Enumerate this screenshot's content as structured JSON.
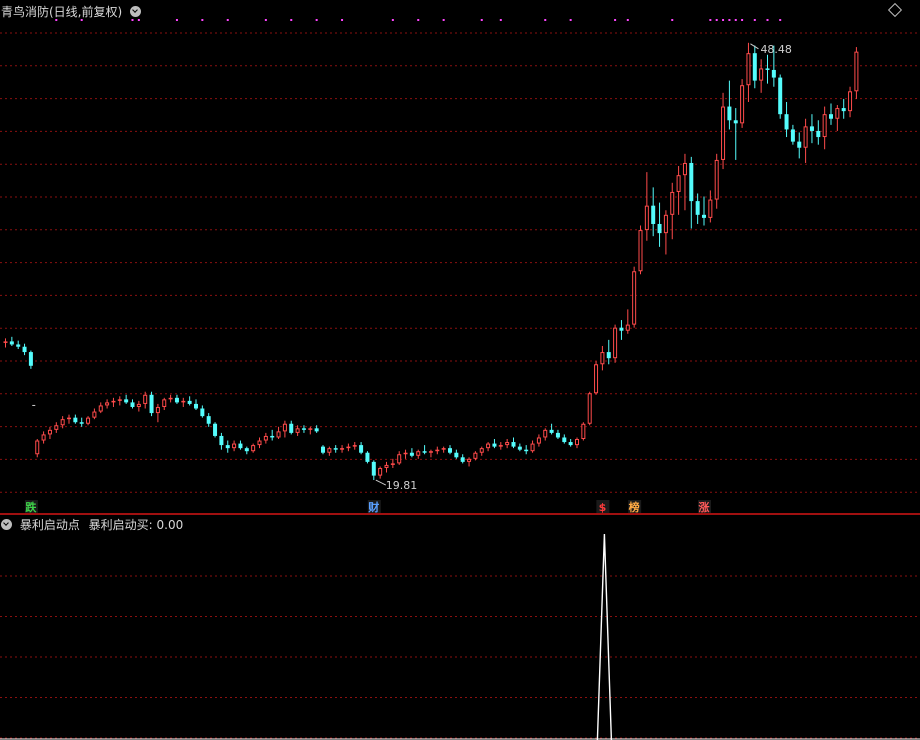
{
  "top_panel": {
    "title": "青鸟消防(日线,前复权)",
    "high_label": "48.48",
    "low_label": "19.81",
    "signal_labels": [
      {
        "index": 4,
        "text": "跌",
        "color": "#3fd24a"
      },
      {
        "index": 58,
        "text": "财",
        "color": "#5aa0ff"
      },
      {
        "index": 94,
        "text": "$",
        "color": "#ff3b3b"
      },
      {
        "index": 99,
        "text": "榜",
        "color": "#ffaa44"
      },
      {
        "index": 110,
        "text": "涨",
        "color": "#ff5a5a"
      }
    ]
  },
  "bottom_panel": {
    "indicator_name": "暴利启动点",
    "indicator_value_text": "暴利启动买: 0.00"
  },
  "colors": {
    "up": "#ff4b4b",
    "down": "#54fcfc",
    "grid": "#8a1010",
    "divider": "#a01010",
    "marker": "#ff44ff",
    "indicator_line": "#ffffff"
  },
  "icons": [
    "collapse-circle-icon",
    "diamond-icon"
  ],
  "chart_data": {
    "type": "candlestick",
    "title": "青鸟消防(日线,前复权)",
    "ylim": [
      18.5,
      50.5
    ],
    "grid": true,
    "candles": [
      [
        28.8,
        29.1,
        28.5,
        28.9
      ],
      [
        28.9,
        29.2,
        28.6,
        28.7
      ],
      [
        28.7,
        28.95,
        28.4,
        28.55
      ],
      [
        28.55,
        28.75,
        28.0,
        28.2
      ],
      [
        28.2,
        28.3,
        27.1,
        27.3
      ],
      [
        21.5,
        22.5,
        21.3,
        22.4
      ],
      [
        22.4,
        23.0,
        22.2,
        22.8
      ],
      [
        22.8,
        23.3,
        22.5,
        23.1
      ],
      [
        23.1,
        23.6,
        22.9,
        23.4
      ],
      [
        23.4,
        24.0,
        23.2,
        23.8
      ],
      [
        23.8,
        24.1,
        23.5,
        23.9
      ],
      [
        23.9,
        24.1,
        23.5,
        23.6
      ],
      [
        23.6,
        23.9,
        23.3,
        23.5
      ],
      [
        23.5,
        24.0,
        23.4,
        23.9
      ],
      [
        23.9,
        24.5,
        23.8,
        24.3
      ],
      [
        24.3,
        24.9,
        24.2,
        24.7
      ],
      [
        24.7,
        25.1,
        24.5,
        24.9
      ],
      [
        24.9,
        25.2,
        24.6,
        25.0
      ],
      [
        25.0,
        25.3,
        24.7,
        25.1
      ],
      [
        25.1,
        25.4,
        24.8,
        24.9
      ],
      [
        24.9,
        25.1,
        24.5,
        24.6
      ],
      [
        24.6,
        25.0,
        24.3,
        24.8
      ],
      [
        24.8,
        25.6,
        24.5,
        25.4
      ],
      [
        25.4,
        25.6,
        24.0,
        24.2
      ],
      [
        24.2,
        24.8,
        23.6,
        24.6
      ],
      [
        24.6,
        25.2,
        24.4,
        25.1
      ],
      [
        25.1,
        25.4,
        24.9,
        25.2
      ],
      [
        25.2,
        25.4,
        24.8,
        24.9
      ],
      [
        24.9,
        25.2,
        24.6,
        25.0
      ],
      [
        25.0,
        25.3,
        24.7,
        24.8
      ],
      [
        24.8,
        25.1,
        24.4,
        24.5
      ],
      [
        24.5,
        24.7,
        23.9,
        24.0
      ],
      [
        24.0,
        24.2,
        23.3,
        23.5
      ],
      [
        23.5,
        23.6,
        22.6,
        22.7
      ],
      [
        22.7,
        22.9,
        21.8,
        22.1
      ],
      [
        22.1,
        22.4,
        21.6,
        21.9
      ],
      [
        21.9,
        22.4,
        21.7,
        22.2
      ],
      [
        22.2,
        22.4,
        21.8,
        21.9
      ],
      [
        21.9,
        22.0,
        21.5,
        21.7
      ],
      [
        21.7,
        22.2,
        21.6,
        22.1
      ],
      [
        22.1,
        22.6,
        21.9,
        22.4
      ],
      [
        22.4,
        22.9,
        22.2,
        22.7
      ],
      [
        22.7,
        23.1,
        22.4,
        22.6
      ],
      [
        22.6,
        23.3,
        22.5,
        23.0
      ],
      [
        23.0,
        23.7,
        22.6,
        23.5
      ],
      [
        23.5,
        23.7,
        22.8,
        22.9
      ],
      [
        22.9,
        23.4,
        22.7,
        23.2
      ],
      [
        23.2,
        23.4,
        22.9,
        23.1
      ],
      [
        23.1,
        23.3,
        22.8,
        23.2
      ],
      [
        23.2,
        23.4,
        22.9,
        23.0
      ],
      [
        22.0,
        22.1,
        21.5,
        21.6
      ],
      [
        21.6,
        22.0,
        21.4,
        21.9
      ],
      [
        21.9,
        22.1,
        21.6,
        21.8
      ],
      [
        21.8,
        22.1,
        21.6,
        21.9
      ],
      [
        21.9,
        22.2,
        21.7,
        22.0
      ],
      [
        22.0,
        22.3,
        21.8,
        22.1
      ],
      [
        22.1,
        22.3,
        21.5,
        21.6
      ],
      [
        21.6,
        21.7,
        20.9,
        21.0
      ],
      [
        21.0,
        21.1,
        19.81,
        20.1
      ],
      [
        20.1,
        20.7,
        19.9,
        20.6
      ],
      [
        20.6,
        21.0,
        20.3,
        20.8
      ],
      [
        20.8,
        21.2,
        20.6,
        20.9
      ],
      [
        20.9,
        21.7,
        20.8,
        21.5
      ],
      [
        21.5,
        21.8,
        21.2,
        21.6
      ],
      [
        21.6,
        21.9,
        21.3,
        21.4
      ],
      [
        21.4,
        21.8,
        21.2,
        21.7
      ],
      [
        21.7,
        22.1,
        21.5,
        21.6
      ],
      [
        21.6,
        21.8,
        21.3,
        21.7
      ],
      [
        21.7,
        22.0,
        21.5,
        21.8
      ],
      [
        21.8,
        22.0,
        21.6,
        21.9
      ],
      [
        21.9,
        22.1,
        21.5,
        21.6
      ],
      [
        21.6,
        21.8,
        21.2,
        21.3
      ],
      [
        21.3,
        21.5,
        20.9,
        21.0
      ],
      [
        21.0,
        21.3,
        20.7,
        21.2
      ],
      [
        21.2,
        21.7,
        21.1,
        21.6
      ],
      [
        21.6,
        22.0,
        21.4,
        21.9
      ],
      [
        21.9,
        22.3,
        21.7,
        22.2
      ],
      [
        22.2,
        22.5,
        21.9,
        22.0
      ],
      [
        22.0,
        22.3,
        21.8,
        22.1
      ],
      [
        22.1,
        22.5,
        21.9,
        22.3
      ],
      [
        22.3,
        22.6,
        21.9,
        22.0
      ],
      [
        22.0,
        22.2,
        21.7,
        21.8
      ],
      [
        21.8,
        22.1,
        21.5,
        21.7
      ],
      [
        21.7,
        22.4,
        21.6,
        22.2
      ],
      [
        22.2,
        22.8,
        22.0,
        22.6
      ],
      [
        22.6,
        23.2,
        22.4,
        23.1
      ],
      [
        23.1,
        23.5,
        22.8,
        22.9
      ],
      [
        22.9,
        23.1,
        22.5,
        22.6
      ],
      [
        22.6,
        22.8,
        22.2,
        22.3
      ],
      [
        22.3,
        22.5,
        22.0,
        22.1
      ],
      [
        22.1,
        22.6,
        21.9,
        22.5
      ],
      [
        22.5,
        23.6,
        22.4,
        23.5
      ],
      [
        23.5,
        25.6,
        23.4,
        25.5
      ],
      [
        25.5,
        27.6,
        25.4,
        27.4
      ],
      [
        27.4,
        28.6,
        27.0,
        28.2
      ],
      [
        28.2,
        29.0,
        27.4,
        27.8
      ],
      [
        27.8,
        30.0,
        27.5,
        29.8
      ],
      [
        29.8,
        30.3,
        29.0,
        29.6
      ],
      [
        29.6,
        31.0,
        29.4,
        30.0
      ],
      [
        30.0,
        33.8,
        29.8,
        33.5
      ],
      [
        33.5,
        36.5,
        33.3,
        36.2
      ],
      [
        36.2,
        40.0,
        35.5,
        37.8
      ],
      [
        37.8,
        39.0,
        35.8,
        36.6
      ],
      [
        36.6,
        38.0,
        35.1,
        36.0
      ],
      [
        36.0,
        37.5,
        34.6,
        37.2
      ],
      [
        37.2,
        39.3,
        35.6,
        38.7
      ],
      [
        38.7,
        40.4,
        37.2,
        39.8
      ],
      [
        39.8,
        41.2,
        37.5,
        40.6
      ],
      [
        40.6,
        41.0,
        36.3,
        38.1
      ],
      [
        38.1,
        38.6,
        36.6,
        37.2
      ],
      [
        37.2,
        38.4,
        36.5,
        37.0
      ],
      [
        37.0,
        38.8,
        36.7,
        38.2
      ],
      [
        38.2,
        41.2,
        37.6,
        40.8
      ],
      [
        40.8,
        45.2,
        40.2,
        44.3
      ],
      [
        44.3,
        46.0,
        42.8,
        43.4
      ],
      [
        43.4,
        44.2,
        40.8,
        43.2
      ],
      [
        43.2,
        46.1,
        42.9,
        45.7
      ],
      [
        45.7,
        48.48,
        44.6,
        47.8
      ],
      [
        47.8,
        48.3,
        45.5,
        46.0
      ],
      [
        46.0,
        47.4,
        45.2,
        46.8
      ],
      [
        46.8,
        47.7,
        45.8,
        46.7
      ],
      [
        46.7,
        48.3,
        45.6,
        46.2
      ],
      [
        46.2,
        46.4,
        43.5,
        43.8
      ],
      [
        43.8,
        44.6,
        42.3,
        42.8
      ],
      [
        42.8,
        43.1,
        41.8,
        42.0
      ],
      [
        42.0,
        42.6,
        40.9,
        41.6
      ],
      [
        41.6,
        43.5,
        40.6,
        43.0
      ],
      [
        43.0,
        43.8,
        41.9,
        42.7
      ],
      [
        42.7,
        43.4,
        41.8,
        42.3
      ],
      [
        42.3,
        44.3,
        41.5,
        43.8
      ],
      [
        43.8,
        44.5,
        43.1,
        43.5
      ],
      [
        43.5,
        44.4,
        42.7,
        44.2
      ],
      [
        44.2,
        44.8,
        43.5,
        44.0
      ],
      [
        44.0,
        45.6,
        43.6,
        45.3
      ],
      [
        45.3,
        48.2,
        44.8,
        47.9
      ]
    ],
    "top_markers": [
      8,
      12,
      20,
      21,
      27,
      31,
      35,
      41,
      45,
      49,
      53,
      61,
      65,
      69,
      75,
      78,
      85,
      89,
      96,
      98,
      105,
      111,
      112,
      113,
      114,
      115,
      116,
      118,
      120,
      122
    ],
    "indicator": {
      "name": "暴利启动买",
      "ylim": [
        0,
        1
      ],
      "values_nonzero": [
        {
          "index": 94,
          "value": 1.0
        }
      ]
    }
  }
}
